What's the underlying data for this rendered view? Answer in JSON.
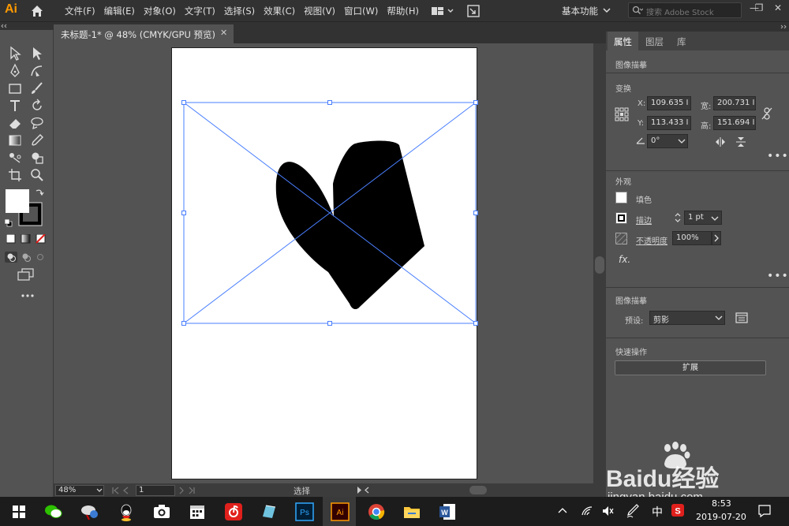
{
  "app": {
    "logo": "Ai",
    "menus": [
      "文件(F)",
      "编辑(E)",
      "对象(O)",
      "文字(T)",
      "选择(S)",
      "效果(C)",
      "视图(V)",
      "窗口(W)",
      "帮助(H)"
    ],
    "workspace": "基本功能",
    "stock_placeholder": "搜索 Adobe Stock",
    "window_buttons": [
      "—",
      "❐",
      "✕"
    ]
  },
  "document": {
    "tab_title": "未标题-1* @ 48% (CMYK/GPU 预览)",
    "close": "✕"
  },
  "status": {
    "zoom": "48%",
    "page": "1",
    "tool_status": "选择"
  },
  "panel": {
    "tabs": [
      "属性",
      "图层",
      "库"
    ],
    "active_tab": "属性",
    "object_type": "图像描摹",
    "transform": {
      "title": "变换",
      "x_label": "X:",
      "x": "109.635 I",
      "y_label": "Y:",
      "y": "113.433 I",
      "w_label": "宽:",
      "w": "200.731 I",
      "h_label": "高:",
      "h": "151.694 I",
      "angle": "0°"
    },
    "appearance": {
      "title": "外观",
      "fill_label": "填色",
      "stroke_label": "描边",
      "stroke_value": "1 pt",
      "opacity_label": "不透明度",
      "opacity_value": "100%",
      "fx": "fx."
    },
    "trace": {
      "title": "图像描摹",
      "preset_label": "预设:",
      "preset_value": "剪影"
    },
    "quick_actions": {
      "title": "快速操作",
      "expand_label": "扩展"
    },
    "more": "•••"
  },
  "taskbar": {
    "ime": "中",
    "time": "8:53",
    "date": "2019-07-20"
  },
  "watermark": {
    "brand": "Baidu经验",
    "url": "jingyan.baidu.com"
  },
  "colors": {
    "ai_orange": "#ff9a00",
    "selection_blue": "#4a7fff",
    "panel_bg": "#535353",
    "menubar_bg": "#323232"
  }
}
